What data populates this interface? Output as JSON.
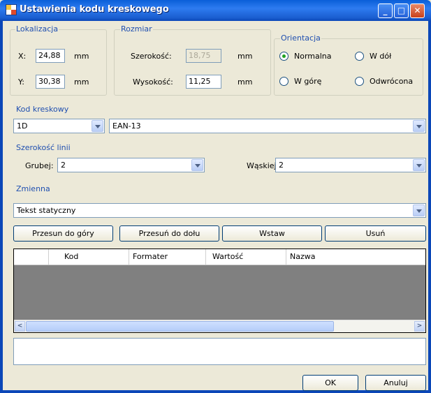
{
  "window": {
    "title": "Ustawienia kodu kreskowego"
  },
  "lokalizacja": {
    "label": "Lokalizacja",
    "x_label": "X:",
    "x_value": "24,88",
    "x_unit": "mm",
    "y_label": "Y:",
    "y_value": "30,38",
    "y_unit": "mm"
  },
  "rozmiar": {
    "label": "Rozmiar",
    "width_label": "Szerokość:",
    "width_value": "18,75",
    "width_unit": "mm",
    "height_label": "Wysokość:",
    "height_value": "11,25",
    "height_unit": "mm"
  },
  "orientacja": {
    "label": "Orientacja",
    "options": [
      "Normalna",
      "W dół",
      "W górę",
      "Odwrócona"
    ],
    "selected": "Normalna"
  },
  "kod": {
    "label": "Kod kreskowy",
    "type_value": "1D",
    "symbology_value": "EAN-13"
  },
  "szerokosc": {
    "label": "Szerokość linii",
    "grubej_label": "Grubej:",
    "grubej_value": "2",
    "waskiej_label": "Wąskiej",
    "waskiej_value": "2"
  },
  "zmienna": {
    "label": "Zmienna",
    "type_value": "Tekst statyczny"
  },
  "buttons": {
    "up": "Przesun do góry",
    "down": "Przesuń do dołu",
    "insert": "Wstaw",
    "delete": "Usuń",
    "ok": "OK",
    "cancel": "Anuluj"
  },
  "table": {
    "columns": [
      "Kod",
      "Formater",
      "Wartość",
      "Nazwa"
    ]
  },
  "colors": {
    "title_bar": "#0a5fd8",
    "group_label": "#1f4fb0",
    "grid_background": "#808080"
  }
}
